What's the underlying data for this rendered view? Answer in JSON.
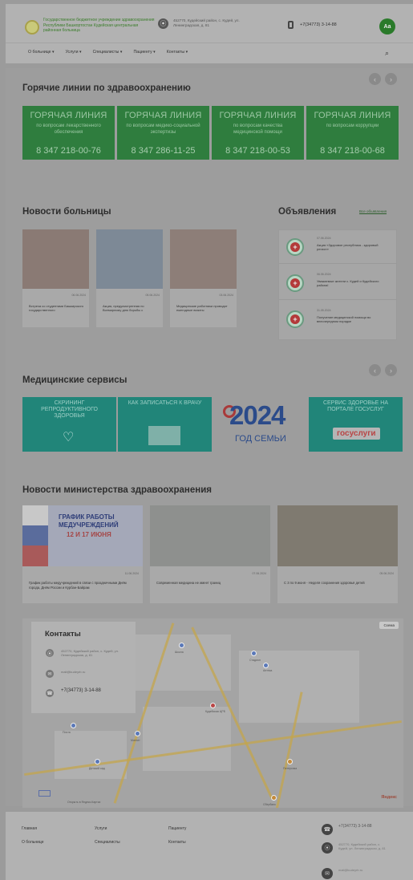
{
  "header": {
    "org_name": "Государственное бюджетное учреждение здравоохранения Республики Башкортостан Кудейская центральная районная больница",
    "logo_icon": "hospital-emblem-icon",
    "address": "452770, Кудейский район, с. Кудей, ул. Ленинградская, д. 81",
    "phone": "+7(34773) 3-14-88",
    "accessibility_btn": "Aa",
    "nav": [
      "О больнице",
      "Услуги",
      "Специалисты",
      "Пациенту",
      "Контакты"
    ],
    "search_icon": "search-icon"
  },
  "hotlines": {
    "title": "Горячие линии по здравоохранению",
    "items": [
      {
        "heading": "ГОРЯЧАЯ ЛИНИЯ",
        "subject": "по вопросам лекарственного обеспечения",
        "phone": "8 347 218-00-76"
      },
      {
        "heading": "ГОРЯЧАЯ ЛИНИЯ",
        "subject": "по вопросам медико-социальной экспертизы",
        "phone": "8 347 286-11-25"
      },
      {
        "heading": "ГОРЯЧАЯ ЛИНИЯ",
        "subject": "по вопросам качества медицинской помощи",
        "phone": "8 347 218-00-53"
      },
      {
        "heading": "ГОРЯЧАЯ ЛИНИЯ",
        "subject": "по вопросам коррупции",
        "phone": "8 347 218-00-68"
      }
    ]
  },
  "hospital_news": {
    "title": "Новости больницы",
    "items": [
      {
        "date": "06.06.2024",
        "title": "Встреча со студентами Башкирского государственного",
        "color": "#8a7a74"
      },
      {
        "date": "05.06.2024",
        "title": "Акция, предусмотренная по Всемирному дню борьбы с",
        "color": "#7d8996"
      },
      {
        "date": "03.06.2024",
        "title": "Медицинские работники проводят ежегодные визиты",
        "color": "#8d7e78"
      }
    ]
  },
  "announcements": {
    "title": "Объявления",
    "all_link": "Все объявления",
    "items": [
      {
        "date": "07.06.2024",
        "title": "Акция «Здоровое республика - здоровый регион»"
      },
      {
        "date": "06.06.2024",
        "title": "Уважаемые жители с. Кудей и Кудейского района!"
      },
      {
        "date": "31.05.2024",
        "title": "Получение медицинской помощи во внеочередном порядке"
      }
    ]
  },
  "services": {
    "title": "Медицинские сервисы",
    "items": [
      {
        "label": "СКРИНИНГ РЕПРОДУКТИВНОГО ЗДОРОВЬЯ"
      },
      {
        "label": "КАК ЗАПИСАТЬСЯ К ВРАЧУ"
      },
      {
        "label": "2024",
        "sub": "ГОД СЕМЬИ"
      },
      {
        "label": "СЕРВИС ЗДОРОВЬЕ НА ПОРТАЛЕ ГОСУСЛУГ",
        "logo": "госуслуги"
      }
    ]
  },
  "ministry_news": {
    "title": "Новости министерства здравоохранения",
    "items": [
      {
        "date": "11.06.2024",
        "title": "График работы медучреждений в связи с праздничными Днём города, Днём России и Курбан-Байрам",
        "banner": "ГРАФИК РАБОТЫ МЕДУЧРЕЖДЕНИЙ",
        "banner_days": "12 И 17 ИЮНЯ"
      },
      {
        "date": "07.06.2024",
        "title": "Современная медицина не имеет границ"
      },
      {
        "date": "05.06.2024",
        "title": "С 3 по 9 июня - Неделя сохранения здоровья детей"
      }
    ]
  },
  "contacts": {
    "title": "Контакты",
    "address": "452770, Кудейский район, с. Кудей, ул. Ленинградская, д. 81",
    "email": "mail@kudeyrb.ru",
    "phone": "+7(34773) 3-14-88"
  },
  "map": {
    "scheme_btn": "Схема",
    "logo": "Яндекс",
    "route_link": "Открыть в Яндекс.Картах",
    "places": [
      "Кудейская ЦРБ",
      "Школа",
      "Аптека",
      "Магнит",
      "Почта",
      "Детский сад",
      "Пятерочка",
      "Стадион",
      "Сбербанк"
    ]
  },
  "footer": {
    "col1": [
      "Главная",
      "О больнице"
    ],
    "col2": [
      "Услуги",
      "Специалисты"
    ],
    "col3": [
      "Пациенту",
      "Контакты"
    ],
    "phone": "+7(34773) 3-14-88",
    "address": "452770, Кудейский район, с. Кудей, ул. Ленинградская, д. 81",
    "email": "mail@kudeyrb.ru"
  }
}
